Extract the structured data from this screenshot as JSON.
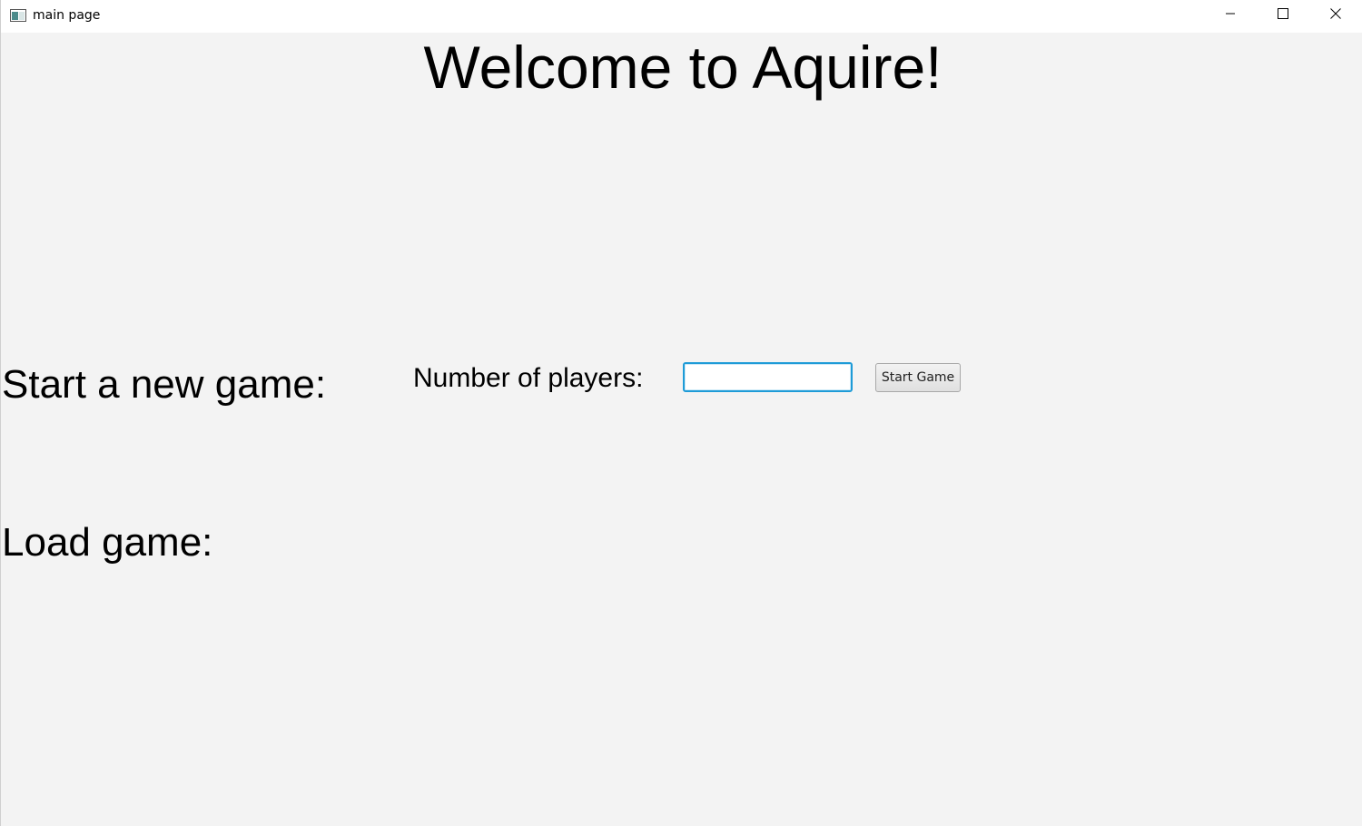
{
  "window": {
    "title": "main page",
    "controls": [
      "minimize-icon",
      "maximize-icon",
      "close-icon"
    ]
  },
  "main": {
    "heading": "Welcome to Aquire!",
    "new_game_label": "Start a new game:",
    "players_label": "Number of players:",
    "players_input_value": "",
    "start_button_label": "Start Game",
    "load_game_label": "Load game:"
  },
  "colors": {
    "background": "#f3f3f3",
    "titlebar": "#ffffff",
    "input_focus_border": "#1e9bd7"
  }
}
